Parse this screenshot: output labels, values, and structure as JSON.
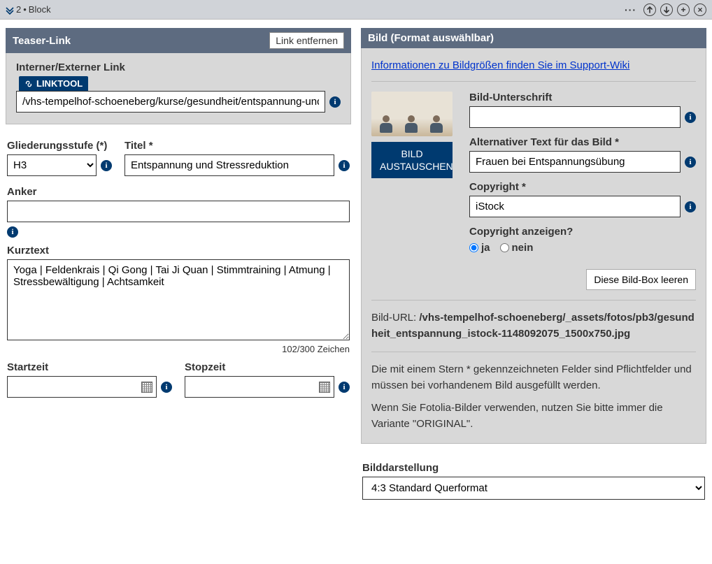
{
  "topbar": {
    "block_num": "2",
    "block_label": "Block"
  },
  "teaser": {
    "header": "Teaser-Link",
    "remove_link_btn": "Link entfernen",
    "internal_external_label": "Interner/Externer Link",
    "linktool_badge": "LINKTOOL",
    "link_value": "/vhs-tempelhof-schoeneberg/kurse/gesundheit/entspannung-und-stressreduktion"
  },
  "fields": {
    "gliederung_label": "Gliederungsstufe (*)",
    "gliederung_value": "H3",
    "titel_label": "Titel *",
    "titel_value": "Entspannung und Stressreduktion",
    "anker_label": "Anker",
    "anker_value": "",
    "kurztext_label": "Kurztext",
    "kurztext_value": "Yoga | Feldenkrais | Qi Gong | Tai Ji Quan | Stimmtraining | Atmung | Stressbewältigung | Achtsamkeit",
    "kurztext_counter": "102/300 Zeichen",
    "startzeit_label": "Startzeit",
    "stopzeit_label": "Stopzeit"
  },
  "image": {
    "header": "Bild (Format auswählbar)",
    "info_link": "Informationen zu Bildgrößen finden Sie im Support-Wiki",
    "swap_btn": "BILD AUSTAUSCHEN",
    "caption_label": "Bild-Unterschrift",
    "caption_value": "",
    "alt_label": "Alternativer Text für das Bild *",
    "alt_value": "Frauen bei Entspannungsübung",
    "copyright_label": "Copyright *",
    "copyright_value": "iStock",
    "show_copyright_label": "Copyright anzeigen?",
    "radio_yes": "ja",
    "radio_no": "nein",
    "clear_btn": "Diese Bild-Box leeren",
    "url_prefix": "Bild-URL: ",
    "url_value": "/vhs-tempelhof-schoeneberg/_assets/fotos/pb3/gesundheit_entspannung_istock-1148092075_1500x750.jpg",
    "help1": "Die mit einem Stern * gekennzeichneten Felder sind Pflichtfelder und müssen bei vorhandenem Bild ausgefüllt werden.",
    "help2": "Wenn Sie Fotolia-Bilder verwenden, nutzen Sie bitte immer die Variante \"ORIGINAL\"."
  },
  "display": {
    "label": "Bilddarstellung",
    "selected": "4:3 Standard Querformat"
  }
}
